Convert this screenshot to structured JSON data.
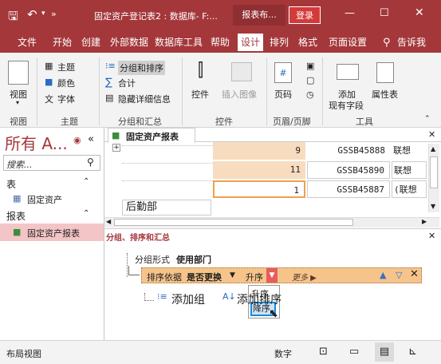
{
  "title": "固定资产登记表2 : 数据库- F:...",
  "report_tools": "报表布...",
  "login": "登录",
  "quick_access": {
    "save": "🖫",
    "undo": "↶",
    "more": "»"
  },
  "window": {
    "min": "—",
    "restore": "☐",
    "close": "✕"
  },
  "tabs": [
    "文件",
    "开始",
    "创建",
    "外部数据",
    "数据库工具",
    "帮助",
    "设计",
    "排列",
    "格式",
    "页面设置"
  ],
  "tell_me": "告诉我",
  "ribbon": {
    "view_label": "视图",
    "theme": "主题",
    "colors": "颜色",
    "fonts": "字体",
    "group_sort": "分组和排序",
    "totals": "合计",
    "hide_details": "隐藏详细信息",
    "controls": "控件",
    "insert_image": "插入图像",
    "page_number": "页码",
    "add_existing_fields_1": "添加",
    "add_existing_fields_2": "现有字段",
    "property_sheet": "属性表",
    "groups": [
      "视图",
      "主题",
      "分组和汇总",
      "控件",
      "页眉/页脚",
      "工具"
    ]
  },
  "nav": {
    "title": "所有 A...",
    "search_placeholder": "搜索...",
    "section_tables": "表",
    "table_item": "固定资产",
    "section_reports": "报表",
    "report_item": "固定资产报表"
  },
  "doc_tab": "固定资产报表",
  "report_rows": [
    {
      "num": "9",
      "code": "GSSB45888",
      "name": "联想"
    },
    {
      "num": "11",
      "code": "GSSB45890",
      "name": "联想"
    },
    {
      "num": "1",
      "code": "GSSB45887",
      "name": "(联想"
    }
  ],
  "dept_text": "后勤部",
  "group_pane": {
    "title": "分组、排序和汇总",
    "group_on_label": "分组形式",
    "group_on_value": "使用部门",
    "sort_by_label": "排序依据",
    "sort_by_value": "是否更换",
    "order_value": "升序",
    "more": "更多 ▶",
    "dropdown_options": [
      "升序",
      "降序"
    ],
    "add_group": "添加组",
    "add_sort": "添加排序"
  },
  "status": {
    "left": "布局视图",
    "numlock": "数字"
  },
  "colors": {
    "accent": "#a4373a",
    "nav_selected": "#f4c5c6",
    "highlight_orange": "#f0a050",
    "sort_row": "#f6c48a"
  }
}
